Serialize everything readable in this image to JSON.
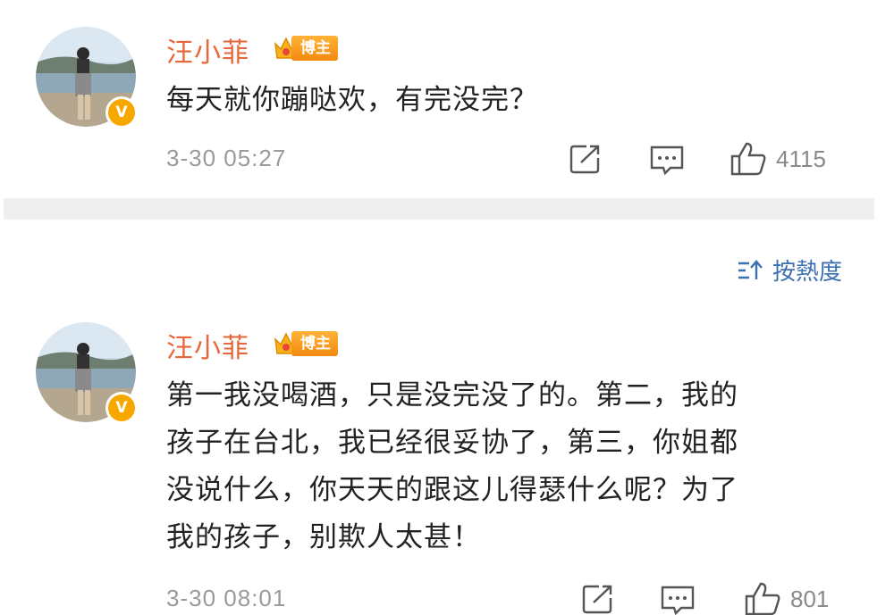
{
  "comments": [
    {
      "username": "汪小菲",
      "badge": "博主",
      "verified_mark": "V",
      "text_lines": [
        "每天就你蹦哒欢，有完没完？"
      ],
      "timestamp": "3-30 05:27",
      "likes": "4115"
    },
    {
      "username": "汪小菲",
      "badge": "博主",
      "verified_mark": "V",
      "text_lines": [
        "第一我没喝酒，只是没完没了的。第二，我的",
        "孩子在台北，我已经很妥协了，第三，你姐都",
        "没说什么，你天天的跟这儿得瑟什么呢？为了",
        "我的孩子，别欺人太甚！"
      ],
      "timestamp": "3-30 08:01",
      "likes": "801"
    }
  ],
  "sort": {
    "label": "按熱度",
    "icon": "sort-icon"
  },
  "icons": {
    "share": "share-icon",
    "comment": "comment-icon",
    "like": "thumbs-up-icon",
    "crown": "crown-icon"
  },
  "colors": {
    "username": "#e8663a",
    "badge": "#f28a10",
    "sort": "#3d6fb3",
    "timestamp": "#9a9a9a",
    "divider": "#efefef"
  }
}
